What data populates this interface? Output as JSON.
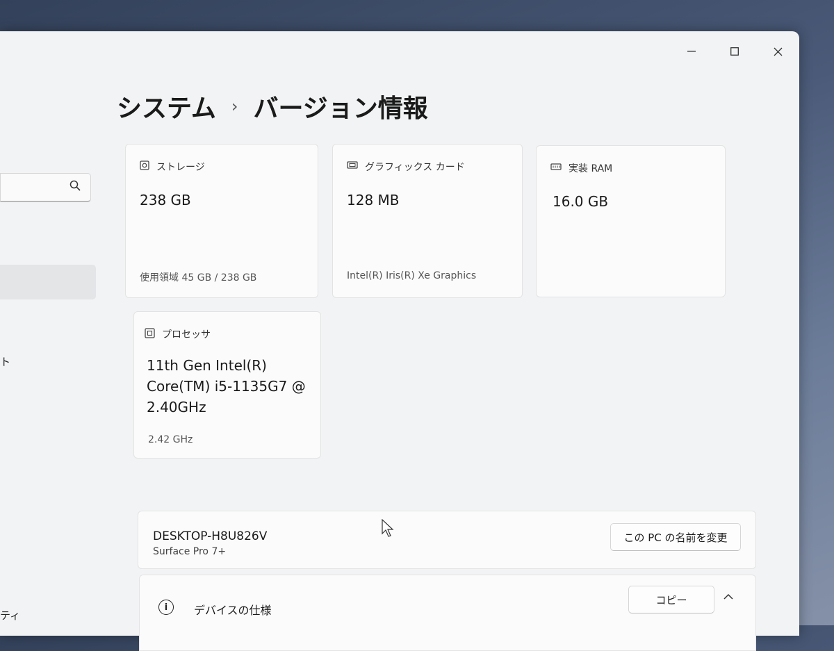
{
  "window": {
    "controls": {
      "minimize": "—",
      "maximize": "☐",
      "close": "✕"
    }
  },
  "breadcrumb": {
    "parent": "システム",
    "separator": "›",
    "current": "バージョン情報"
  },
  "sidebar": {
    "search_icon": "search-icon",
    "fragments": [
      "ト",
      "ティ"
    ]
  },
  "cards": {
    "storage": {
      "icon": "storage-icon",
      "label": "ストレージ",
      "value": "238 GB",
      "detail": "使用領域 45 GB / 238 GB"
    },
    "graphics": {
      "icon": "graphics-card-icon",
      "label": "グラフィックス カード",
      "value": "128 MB",
      "detail": "Intel(R) Iris(R) Xe Graphics"
    },
    "ram": {
      "icon": "memory-icon",
      "label": "実装 RAM",
      "value": "16.0 GB"
    },
    "processor": {
      "icon": "processor-icon",
      "label": "プロセッサ",
      "value": "11th Gen Intel(R) Core(TM) i5-1135G7 @ 2.40GHz",
      "detail": "2.42 GHz"
    }
  },
  "device": {
    "name": "DESKTOP-H8U826V",
    "model": "Surface Pro 7+",
    "rename_label": "この PC の名前を変更"
  },
  "specs": {
    "icon": "info-icon",
    "label": "デバイスの仕様",
    "copy_label": "コピー",
    "chevron": "chevron-up-icon"
  }
}
